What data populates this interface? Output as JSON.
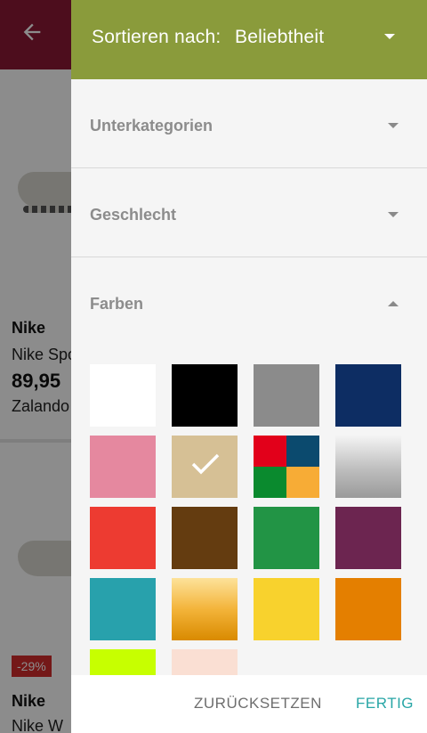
{
  "background": {
    "products": [
      {
        "brand": "Nike",
        "name": "Nike Spo",
        "price": "89,95",
        "shop": "Zalando"
      },
      {
        "brand": "Nike",
        "name": "Nike W",
        "badge": "-29%"
      }
    ]
  },
  "drawer": {
    "sort": {
      "label": "Sortieren nach:",
      "value": "Beliebtheit"
    },
    "sections": [
      {
        "label": "Unterkategorien",
        "expanded": false
      },
      {
        "label": "Geschlecht",
        "expanded": false
      },
      {
        "label": "Farben",
        "expanded": true
      }
    ],
    "colors": [
      {
        "name": "weiss",
        "fill": "#ffffff",
        "selected": false
      },
      {
        "name": "schwarz",
        "fill": "#000000",
        "selected": false
      },
      {
        "name": "grau",
        "fill": "#8b8b8b",
        "selected": false
      },
      {
        "name": "blau",
        "fill": "#0d2d63",
        "selected": false
      },
      {
        "name": "rosa",
        "fill": "#e5889f",
        "selected": false
      },
      {
        "name": "beige",
        "fill": "#d6c095",
        "selected": true
      },
      {
        "name": "mehrfarbig",
        "fill": "multi",
        "selected": false
      },
      {
        "name": "silber",
        "fill": "silver-gradient",
        "selected": false
      },
      {
        "name": "rot",
        "fill": "#ed3b31",
        "selected": false
      },
      {
        "name": "braun",
        "fill": "#643c10",
        "selected": false
      },
      {
        "name": "gruen",
        "fill": "#229445",
        "selected": false
      },
      {
        "name": "lila",
        "fill": "#6c2550",
        "selected": false
      },
      {
        "name": "tuerkis",
        "fill": "#28a1ac",
        "selected": false
      },
      {
        "name": "gold",
        "fill": "gold-gradient",
        "selected": false
      },
      {
        "name": "gelb",
        "fill": "#f8d22d",
        "selected": false
      },
      {
        "name": "orange",
        "fill": "#e47f00",
        "selected": false
      },
      {
        "name": "neongelb",
        "fill": "#c7ff00",
        "selected": false
      },
      {
        "name": "hautfarben",
        "fill": "#fadfd3",
        "selected": false
      }
    ],
    "footer": {
      "reset_label": "ZURÜCKSETZEN",
      "done_label": "FERTIG"
    }
  },
  "theme": {
    "header_color": "#8a9b3b",
    "accent": "#28a6a6",
    "app_bar": "#8c1836"
  }
}
